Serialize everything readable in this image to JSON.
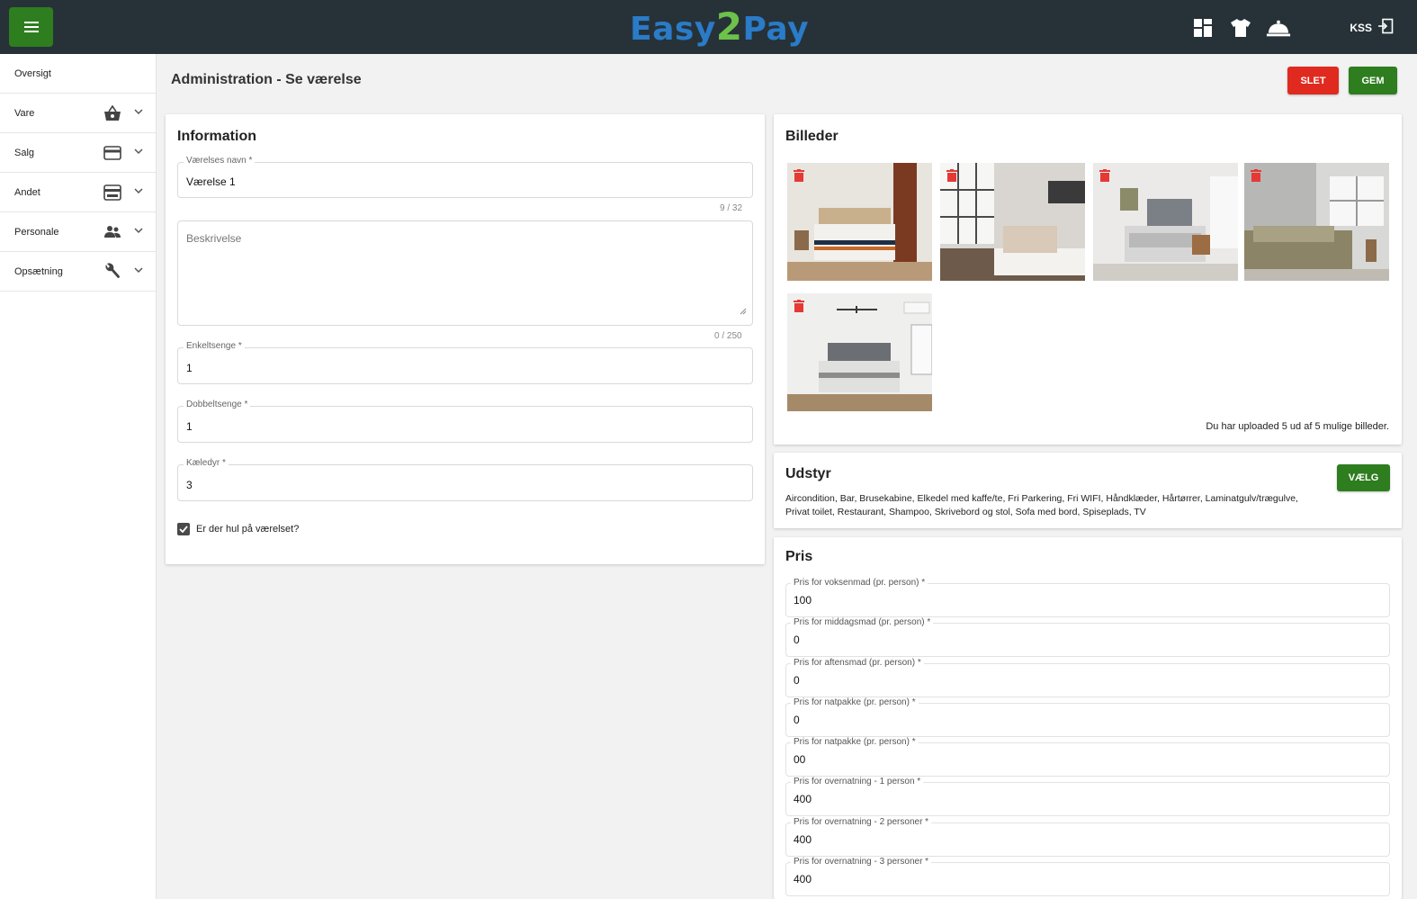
{
  "app": {
    "logo": {
      "part1": "Easy",
      "part2": "2",
      "part3": "Pay"
    },
    "user_label": "KSS"
  },
  "sidebar": {
    "items": [
      {
        "label": "Oversigt",
        "icon": "",
        "has_chevron": false
      },
      {
        "label": "Vare",
        "icon": "basket-icon",
        "has_chevron": true
      },
      {
        "label": "Salg",
        "icon": "credit-card-icon",
        "has_chevron": true
      },
      {
        "label": "Andet",
        "icon": "card-terminal-icon",
        "has_chevron": true
      },
      {
        "label": "Personale",
        "icon": "people-icon",
        "has_chevron": true
      },
      {
        "label": "Opsætning",
        "icon": "wrench-icon",
        "has_chevron": true
      }
    ]
  },
  "header": {
    "title": "Administration - Se værelse",
    "delete_label": "SLET",
    "save_label": "GEM"
  },
  "information": {
    "title": "Information",
    "room_name": {
      "label": "Værelses navn *",
      "value": "Værelse 1",
      "counter": "9 / 32"
    },
    "description": {
      "placeholder": "Beskrivelse",
      "counter": "0 / 250"
    },
    "single_beds": {
      "label": "Enkeltsenge *",
      "value": "1"
    },
    "double_beds": {
      "label": "Dobbeltsenge *",
      "value": "1"
    },
    "pets": {
      "label": "Kæledyr *",
      "value": "3"
    },
    "hole_checkbox": {
      "label": "Er der hul på værelset?",
      "checked": true
    }
  },
  "images": {
    "title": "Billeder",
    "upload_status": "Du har uploaded 5 ud af 5 mulige billeder."
  },
  "equipment": {
    "title": "Udstyr",
    "choose_label": "VÆLG",
    "line1": "Aircondition, Bar, Brusekabine, Elkedel med kaffe/te, Fri Parkering, Fri WIFI, Håndklæder, Hårtørrer, Laminatgulv/trægulve,",
    "line2": "Privat toilet, Restaurant, Shampoo, Skrivebord og stol, Sofa med bord, Spiseplads, TV"
  },
  "prices": {
    "title": "Pris",
    "fields": [
      {
        "label": "Pris for voksenmad (pr. person) *",
        "value": "100"
      },
      {
        "label": "Pris for middagsmad (pr. person) *",
        "value": "0"
      },
      {
        "label": "Pris for aftensmad (pr. person) *",
        "value": "0"
      },
      {
        "label": "Pris for natpakke (pr. person) *",
        "value": "0"
      },
      {
        "label": "Pris for natpakke (pr. person) *",
        "value": "00"
      },
      {
        "label": "Pris for overnatning - 1 person *",
        "value": "400"
      },
      {
        "label": "Pris for overnatning - 2 personer *",
        "value": "400"
      },
      {
        "label": "Pris for overnatning - 3 personer *",
        "value": "400"
      }
    ]
  },
  "colors": {
    "topbar": "#263238",
    "primary_green": "#2e7d1f",
    "danger_red": "#e02a1f"
  }
}
